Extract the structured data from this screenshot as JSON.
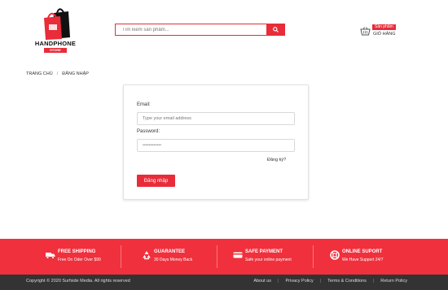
{
  "header": {
    "logo_text": "HANDPHONE",
    "logo_sub": "STORE",
    "search_placeholder": "Tìm kiếm sản phẩm...",
    "cart_badge": "Sản phẩm",
    "cart_label": "GIỎ HÀNG"
  },
  "breadcrumb": {
    "home": "TRANG CHỦ",
    "separator": "/",
    "current": "ĐĂNG NHẬP"
  },
  "login": {
    "email_label": "Email:",
    "email_placeholder": "Type your email address",
    "password_label": "Password:",
    "password_value": "••••••••••••",
    "register_link": "Đăng ký?",
    "submit_label": "Đăng nhập"
  },
  "features": [
    {
      "icon": "truck-icon",
      "title": "FREE SHIPPING",
      "subtitle": "Free On Oder Over $99"
    },
    {
      "icon": "recycle-icon",
      "title": "GUARANTEE",
      "subtitle": "30 Days Money Back"
    },
    {
      "icon": "credit-card-icon",
      "title": "SAFE PAYMENT",
      "subtitle": "Safe your online payment"
    },
    {
      "icon": "lifebuoy-icon",
      "title": "ONLINE SUPORT",
      "subtitle": "We Have Support 24/7"
    }
  ],
  "footer": {
    "copyright": "Copyright © 2020 Surfside Media. All rights reserved",
    "links": [
      "About us",
      "Privacy Policy",
      "Terms & Conditions",
      "Return Policy"
    ]
  },
  "colors": {
    "accent": "#e82c3a",
    "band": "#f0303c",
    "footer": "#333333"
  }
}
